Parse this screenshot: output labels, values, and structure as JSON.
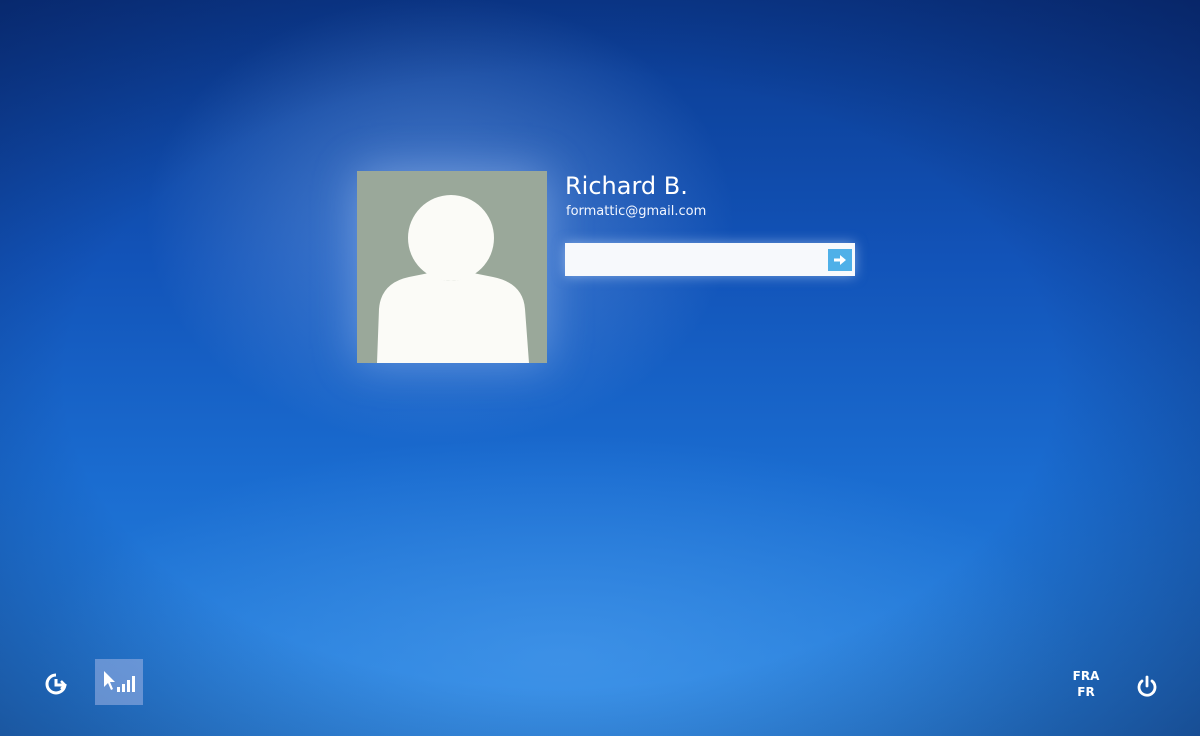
{
  "user": {
    "name": "Richard B.",
    "email": "formattic@gmail.com"
  },
  "password": {
    "value": "",
    "placeholder": ""
  },
  "language": {
    "code": "FRA",
    "sub": "FR"
  },
  "icons": {
    "submit": "arrow-right-icon",
    "ease_of_access": "ease-of-access-icon",
    "network": "network-signal-icon",
    "power": "power-icon",
    "avatar": "user-silhouette-icon"
  },
  "colors": {
    "accent": "#4fb0e8",
    "background_top": "#0b3a8f",
    "background_bottom": "#2a86e0",
    "avatar_bg": "#9aa89a"
  }
}
